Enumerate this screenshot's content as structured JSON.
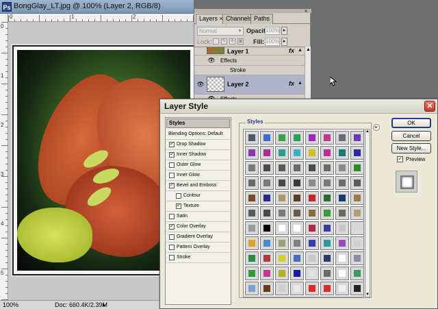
{
  "document": {
    "title": "BongGlay_LT.jpg @ 100% (Layer 2, RGB/8)",
    "app_icon": "Ps",
    "ruler_labels_h": [
      "0",
      "1",
      "2",
      "3"
    ],
    "ruler_labels_v": [
      "0",
      "1",
      "2",
      "3",
      "4",
      "5"
    ],
    "zoom": "100%",
    "doc_size": "Doc: 660.4K/2.39M",
    "status_arrow": "▸"
  },
  "layers_panel": {
    "tabs": [
      {
        "label": "Layers ×",
        "active": true
      },
      {
        "label": "Channels",
        "active": false
      },
      {
        "label": "Paths",
        "active": false
      }
    ],
    "close": "×",
    "blend_mode": "Normal",
    "opacity_label": "Opacity:",
    "opacity_value": "100%",
    "lock_label": "Lock:",
    "fill_label": "Fill:",
    "fill_value": "100%",
    "layers": [
      {
        "name": "Layer 1",
        "fx": "fx",
        "effects_label": "Effects",
        "sub_effects": [
          "Stroke"
        ]
      },
      {
        "name": "Layer 2",
        "fx": "fx",
        "effects_label": "Effects",
        "selected": true
      }
    ]
  },
  "dialog": {
    "title": "Layer Style",
    "close": "✕",
    "styles_header": "Styles",
    "items": [
      {
        "label": "Blending Options: Default",
        "check": null
      },
      {
        "label": "Drop Shadow",
        "check": true
      },
      {
        "label": "Inner Shadow",
        "check": true
      },
      {
        "label": "Outer Glow",
        "check": false
      },
      {
        "label": "Inner Glow",
        "check": false
      },
      {
        "label": "Bevel and Emboss",
        "check": true
      },
      {
        "label": "Contour",
        "check": false,
        "indent": true
      },
      {
        "label": "Texture",
        "check": true,
        "indent": true
      },
      {
        "label": "Satin",
        "check": false
      },
      {
        "label": "Color Overlay",
        "check": true
      },
      {
        "label": "Gradient Overlay",
        "check": false
      },
      {
        "label": "Pattern Overlay",
        "check": false
      },
      {
        "label": "Stroke",
        "check": false
      }
    ],
    "styles_group_label": "Styles",
    "menu_arrow": "▸",
    "swatch_rows": [
      [
        "#4a5a6a",
        "#3a6bd0",
        "#3aa04a",
        "#2aa05a",
        "#a02ac0",
        "#c03a8a",
        "#6a6a7a",
        "#6a3ab0"
      ],
      [
        "#8a3ab0",
        "#b02a9a",
        "#2aa08a",
        "#3ab0c0",
        "#d0c020",
        "#c02aa0",
        "#1a7a7a",
        "#2a2aa0"
      ],
      [
        "#7a7a7a",
        "#4a4a4a",
        "#5a5a5a",
        "#6a6a6a",
        "#4a4a4a",
        "#6a6a6a",
        "#8a8a8a",
        "#2a8a2a"
      ],
      [
        "#6a6a6a",
        "#7a7a7a",
        "#4a4a4a",
        "#3a3a3a",
        "#8a8a8a",
        "#7a7a7a",
        "#6a6a6a",
        "#5a5a5a"
      ],
      [
        "#7a4a2a",
        "#2a2a8a",
        "#aa9a6a",
        "#5a3a2a",
        "#c02a2a",
        "#2a6a2a",
        "#1a3a6a",
        "#a07a4a"
      ],
      [
        "#5a5a5a",
        "#4a4a4a",
        "#7a7a7a",
        "#6a5a4a",
        "#8a6a3a",
        "#3a9a3a",
        "#6a6a5a",
        "#b0a070"
      ],
      [
        "#9a9a9a",
        "#000000",
        "#ffffff",
        "#ffffff",
        "#b02a4a",
        "#3a3aa0",
        "#c8c8c8",
        "#d8d8d8"
      ],
      [
        "#e0a020",
        "#4a8ad0",
        "#a0a070",
        "#808080",
        "#3a3ab0",
        "#2a9aa0",
        "#9a4ac0",
        "#d0d0d0"
      ],
      [
        "#2a8a4a",
        "#b03a3a",
        "#d0d030",
        "#4a6ac0",
        "#c8c8c8",
        "#2a3a6a",
        "#ffffff",
        "#8a8aa0"
      ],
      [
        "#2a9a3a",
        "#c03a90",
        "#b0b020",
        "#1a1aa0",
        "#e0e0e0",
        "#6a6a6a",
        "#ffffff",
        "#3a9a5a"
      ],
      [
        "#7aa0d0",
        "#6a3a1a",
        "#cfcfcf",
        "#e8e8e8",
        "#e02a2a",
        "#e02a2a",
        "#eeeeee",
        "#222222"
      ],
      [
        "#aaaaaa",
        "#f2f2f2",
        "#e8e8e8",
        "#3a3ad0",
        "#e02a8a",
        "#d0d0d0",
        "#7a7a7a",
        "#999999"
      ]
    ],
    "scroll_up": "▲",
    "scroll_down": "▼",
    "ok": "OK",
    "cancel": "Cancel",
    "new_style": "New Style...",
    "preview_label": "Preview"
  }
}
